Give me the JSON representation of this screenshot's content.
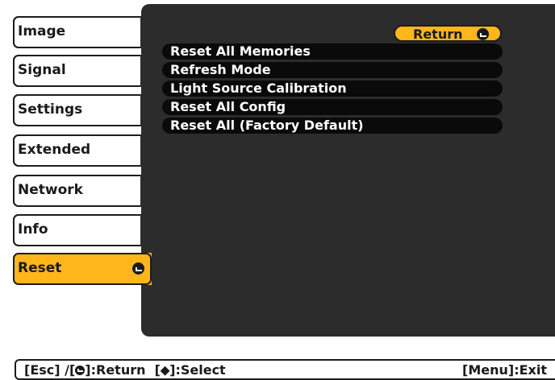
{
  "sidebar": {
    "items": [
      {
        "label": "Image"
      },
      {
        "label": "Signal"
      },
      {
        "label": "Settings"
      },
      {
        "label": "Extended"
      },
      {
        "label": "Network"
      },
      {
        "label": "Info"
      },
      {
        "label": "Reset"
      }
    ],
    "selected": "Reset"
  },
  "main": {
    "return_label": "Return",
    "items": [
      {
        "label": "Reset All Memories"
      },
      {
        "label": "Refresh Mode"
      },
      {
        "label": "Light Source Calibration"
      },
      {
        "label": "Reset All Config"
      },
      {
        "label": "Reset All (Factory Default)"
      }
    ]
  },
  "status": {
    "esc": "[Esc] /[",
    "return": "]:Return",
    "select": "[⬥]:Select",
    "exit": "[Menu]:Exit"
  },
  "colors": {
    "accent": "#ffb61c",
    "panel": "#2c2c2c",
    "item": "#0a0a0a"
  }
}
